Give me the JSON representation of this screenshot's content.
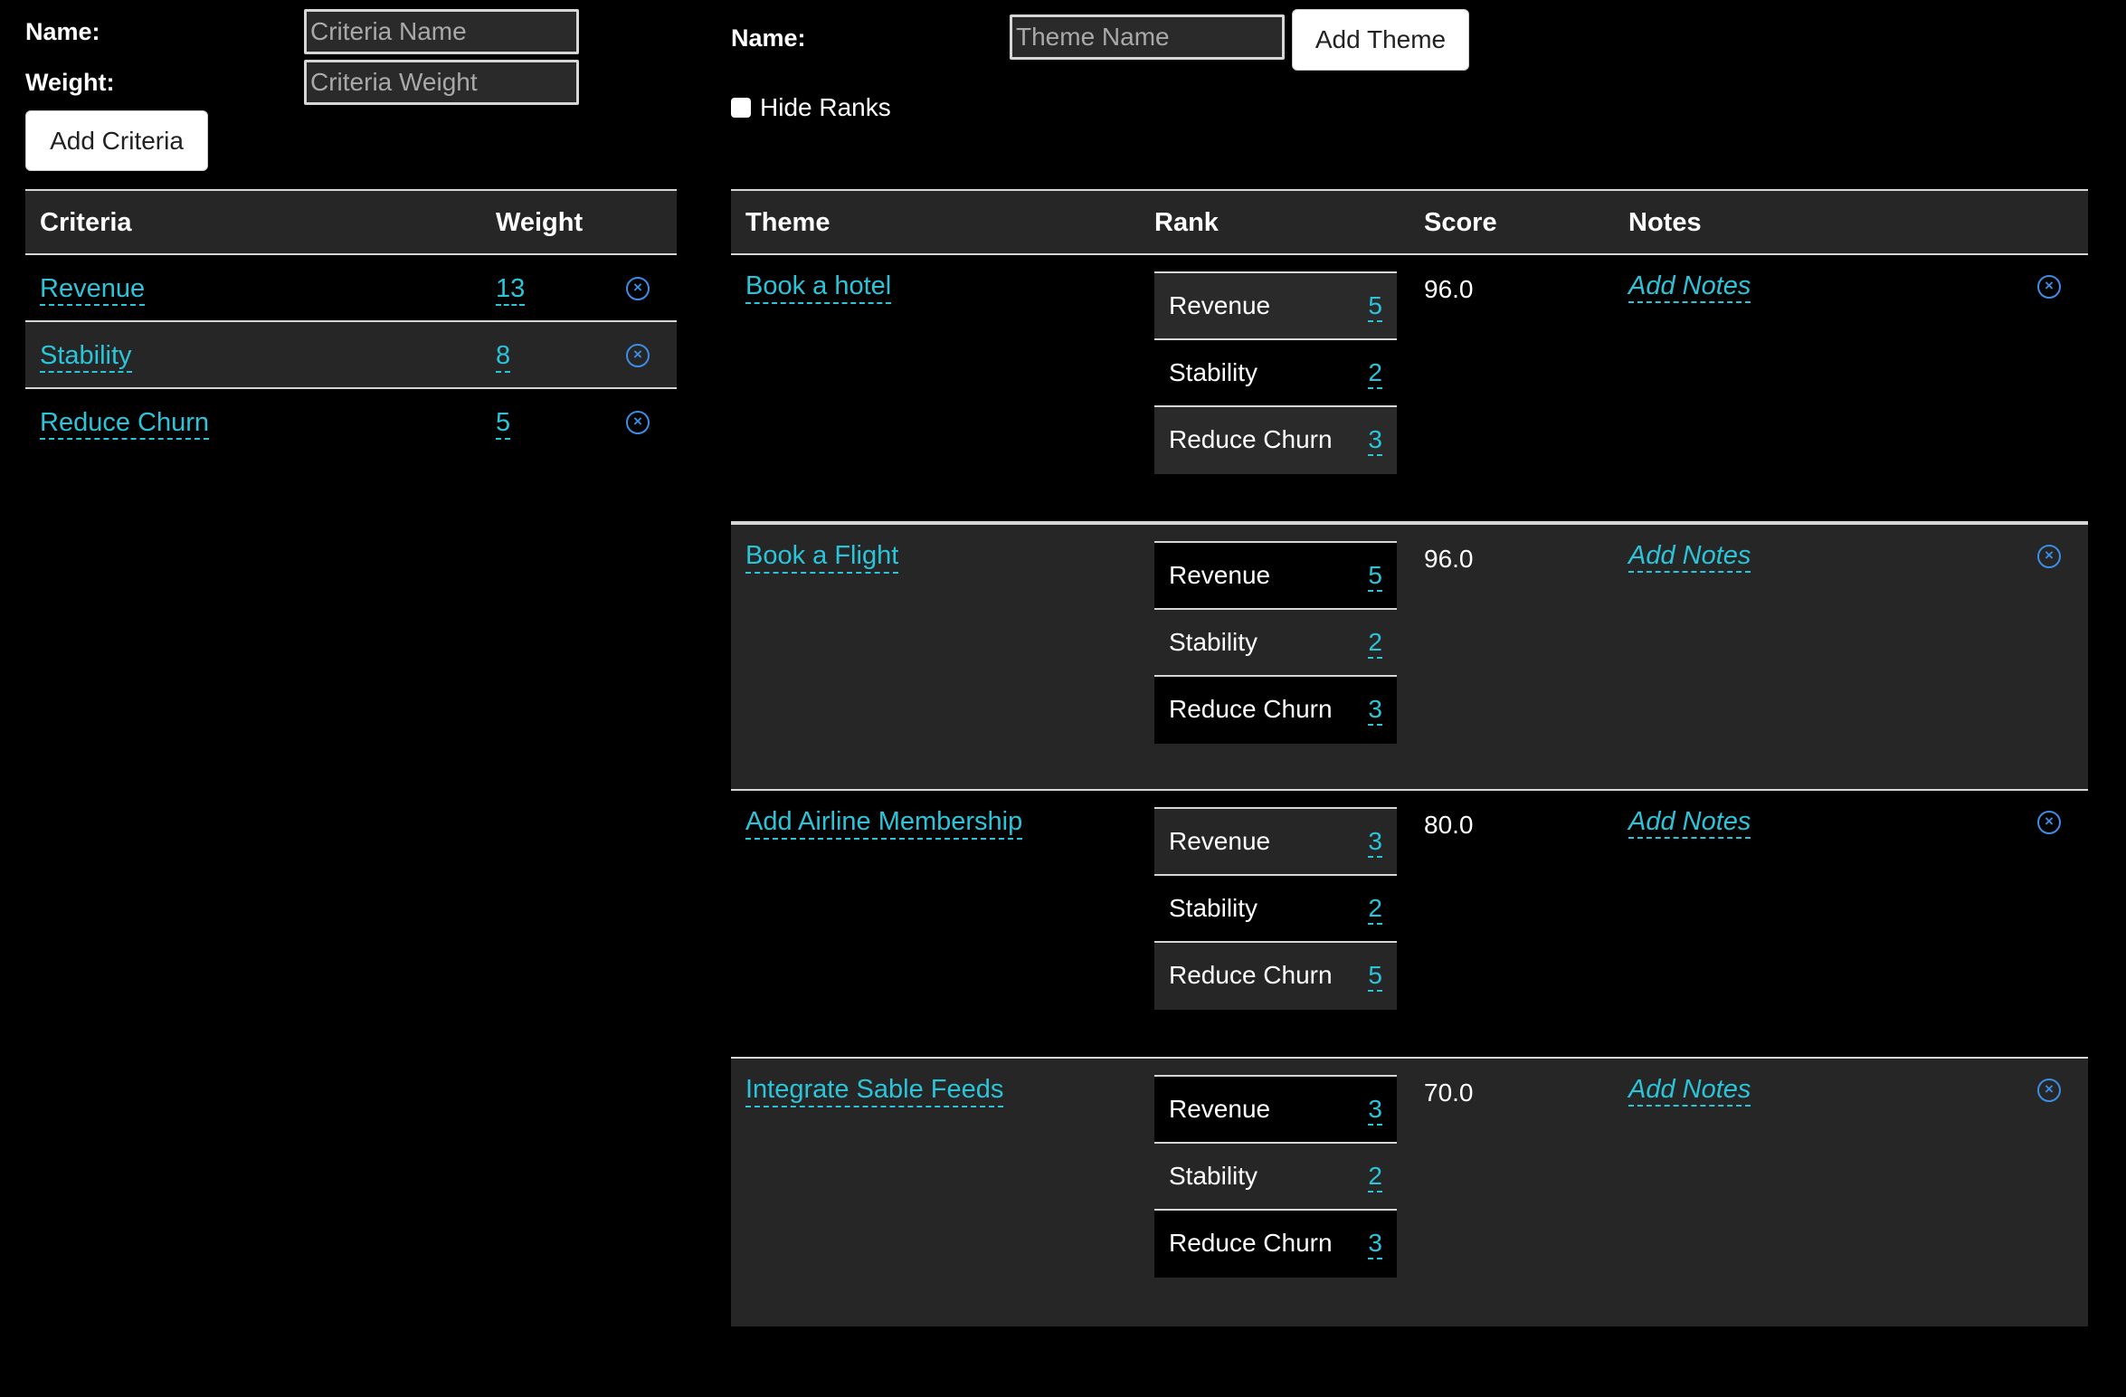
{
  "criteria_form": {
    "name_label": "Name:",
    "weight_label": "Weight:",
    "name_placeholder": "Criteria Name",
    "weight_placeholder": "Criteria Weight",
    "add_button": "Add Criteria"
  },
  "theme_form": {
    "name_label": "Name:",
    "name_placeholder": "Theme Name",
    "add_button": "Add Theme",
    "hide_ranks_label": "Hide Ranks"
  },
  "criteria_table": {
    "headers": {
      "criteria": "Criteria",
      "weight": "Weight"
    },
    "rows": [
      {
        "name": "Revenue",
        "weight": "13"
      },
      {
        "name": "Stability",
        "weight": "8"
      },
      {
        "name": "Reduce Churn",
        "weight": "5"
      }
    ]
  },
  "themes_table": {
    "headers": {
      "theme": "Theme",
      "rank": "Rank",
      "score": "Score",
      "notes": "Notes"
    },
    "rows": [
      {
        "name": "Book a hotel",
        "score": "96.0",
        "notes": "Add Notes",
        "ranks": [
          {
            "criteria": "Revenue",
            "value": "5"
          },
          {
            "criteria": "Stability",
            "value": "2"
          },
          {
            "criteria": "Reduce Churn",
            "value": "3"
          }
        ]
      },
      {
        "name": "Book a Flight",
        "score": "96.0",
        "notes": "Add Notes",
        "ranks": [
          {
            "criteria": "Revenue",
            "value": "5"
          },
          {
            "criteria": "Stability",
            "value": "2"
          },
          {
            "criteria": "Reduce Churn",
            "value": "3"
          }
        ]
      },
      {
        "name": "Add Airline Membership",
        "score": "80.0",
        "notes": "Add Notes",
        "ranks": [
          {
            "criteria": "Revenue",
            "value": "3"
          },
          {
            "criteria": "Stability",
            "value": "2"
          },
          {
            "criteria": "Reduce Churn",
            "value": "5"
          }
        ]
      },
      {
        "name": "Integrate Sable Feeds",
        "score": "70.0",
        "notes": "Add Notes",
        "ranks": [
          {
            "criteria": "Revenue",
            "value": "3"
          },
          {
            "criteria": "Stability",
            "value": "2"
          },
          {
            "criteria": "Reduce Churn",
            "value": "3"
          }
        ]
      }
    ]
  },
  "icons": {
    "remove": "close-circle-icon"
  },
  "colors": {
    "link": "#2bc4d9",
    "remove_icon": "#3c8de3",
    "row_alt": "#262626",
    "background": "#000000"
  }
}
